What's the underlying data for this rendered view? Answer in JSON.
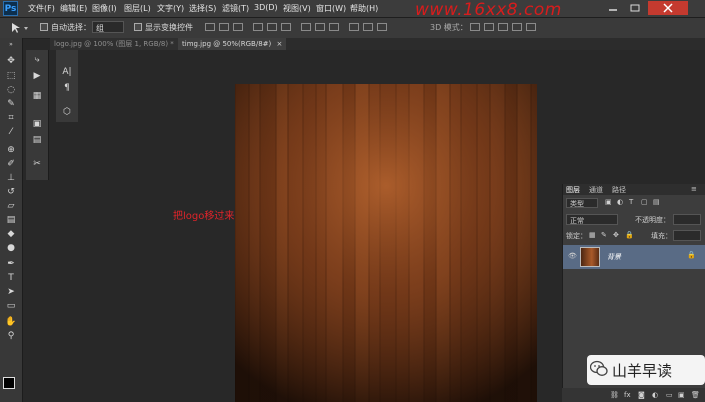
{
  "app": {
    "logo": "Ps"
  },
  "menu": [
    "文件(F)",
    "编辑(E)",
    "图像(I)",
    "图层(L)",
    "文字(Y)",
    "选择(S)",
    "滤镜(T)",
    "3D(D)",
    "视图(V)",
    "窗口(W)",
    "帮助(H)"
  ],
  "watermark": "www.16xx8.com",
  "options_bar": {
    "auto_select_label": "自动选择：",
    "auto_select_value": "组",
    "show_transform_label": "显示变换控件",
    "mode_3d_label": "3D 模式："
  },
  "tabs": [
    {
      "label": "logo.jpg @ 100% (图层 1, RGB/8) *",
      "active": false
    },
    {
      "label": "timg.jpg @ 50%(RGB/8#)",
      "active": true
    }
  ],
  "annotation": "把logo移过来",
  "layers_panel": {
    "tabs": [
      "图层",
      "通道",
      "路径"
    ],
    "filter_kind": "类型",
    "blend_mode": "正常",
    "opacity_label": "不透明度：",
    "lock_label": "锁定：",
    "fill_label": "填充：",
    "layer_name": "背景"
  },
  "wechat_badge": "山羊早读",
  "colors": {
    "menubar": "#3c3c3c",
    "panel": "#3d3d3d",
    "selected_layer": "#596b85",
    "annotation": "#e0242a"
  }
}
